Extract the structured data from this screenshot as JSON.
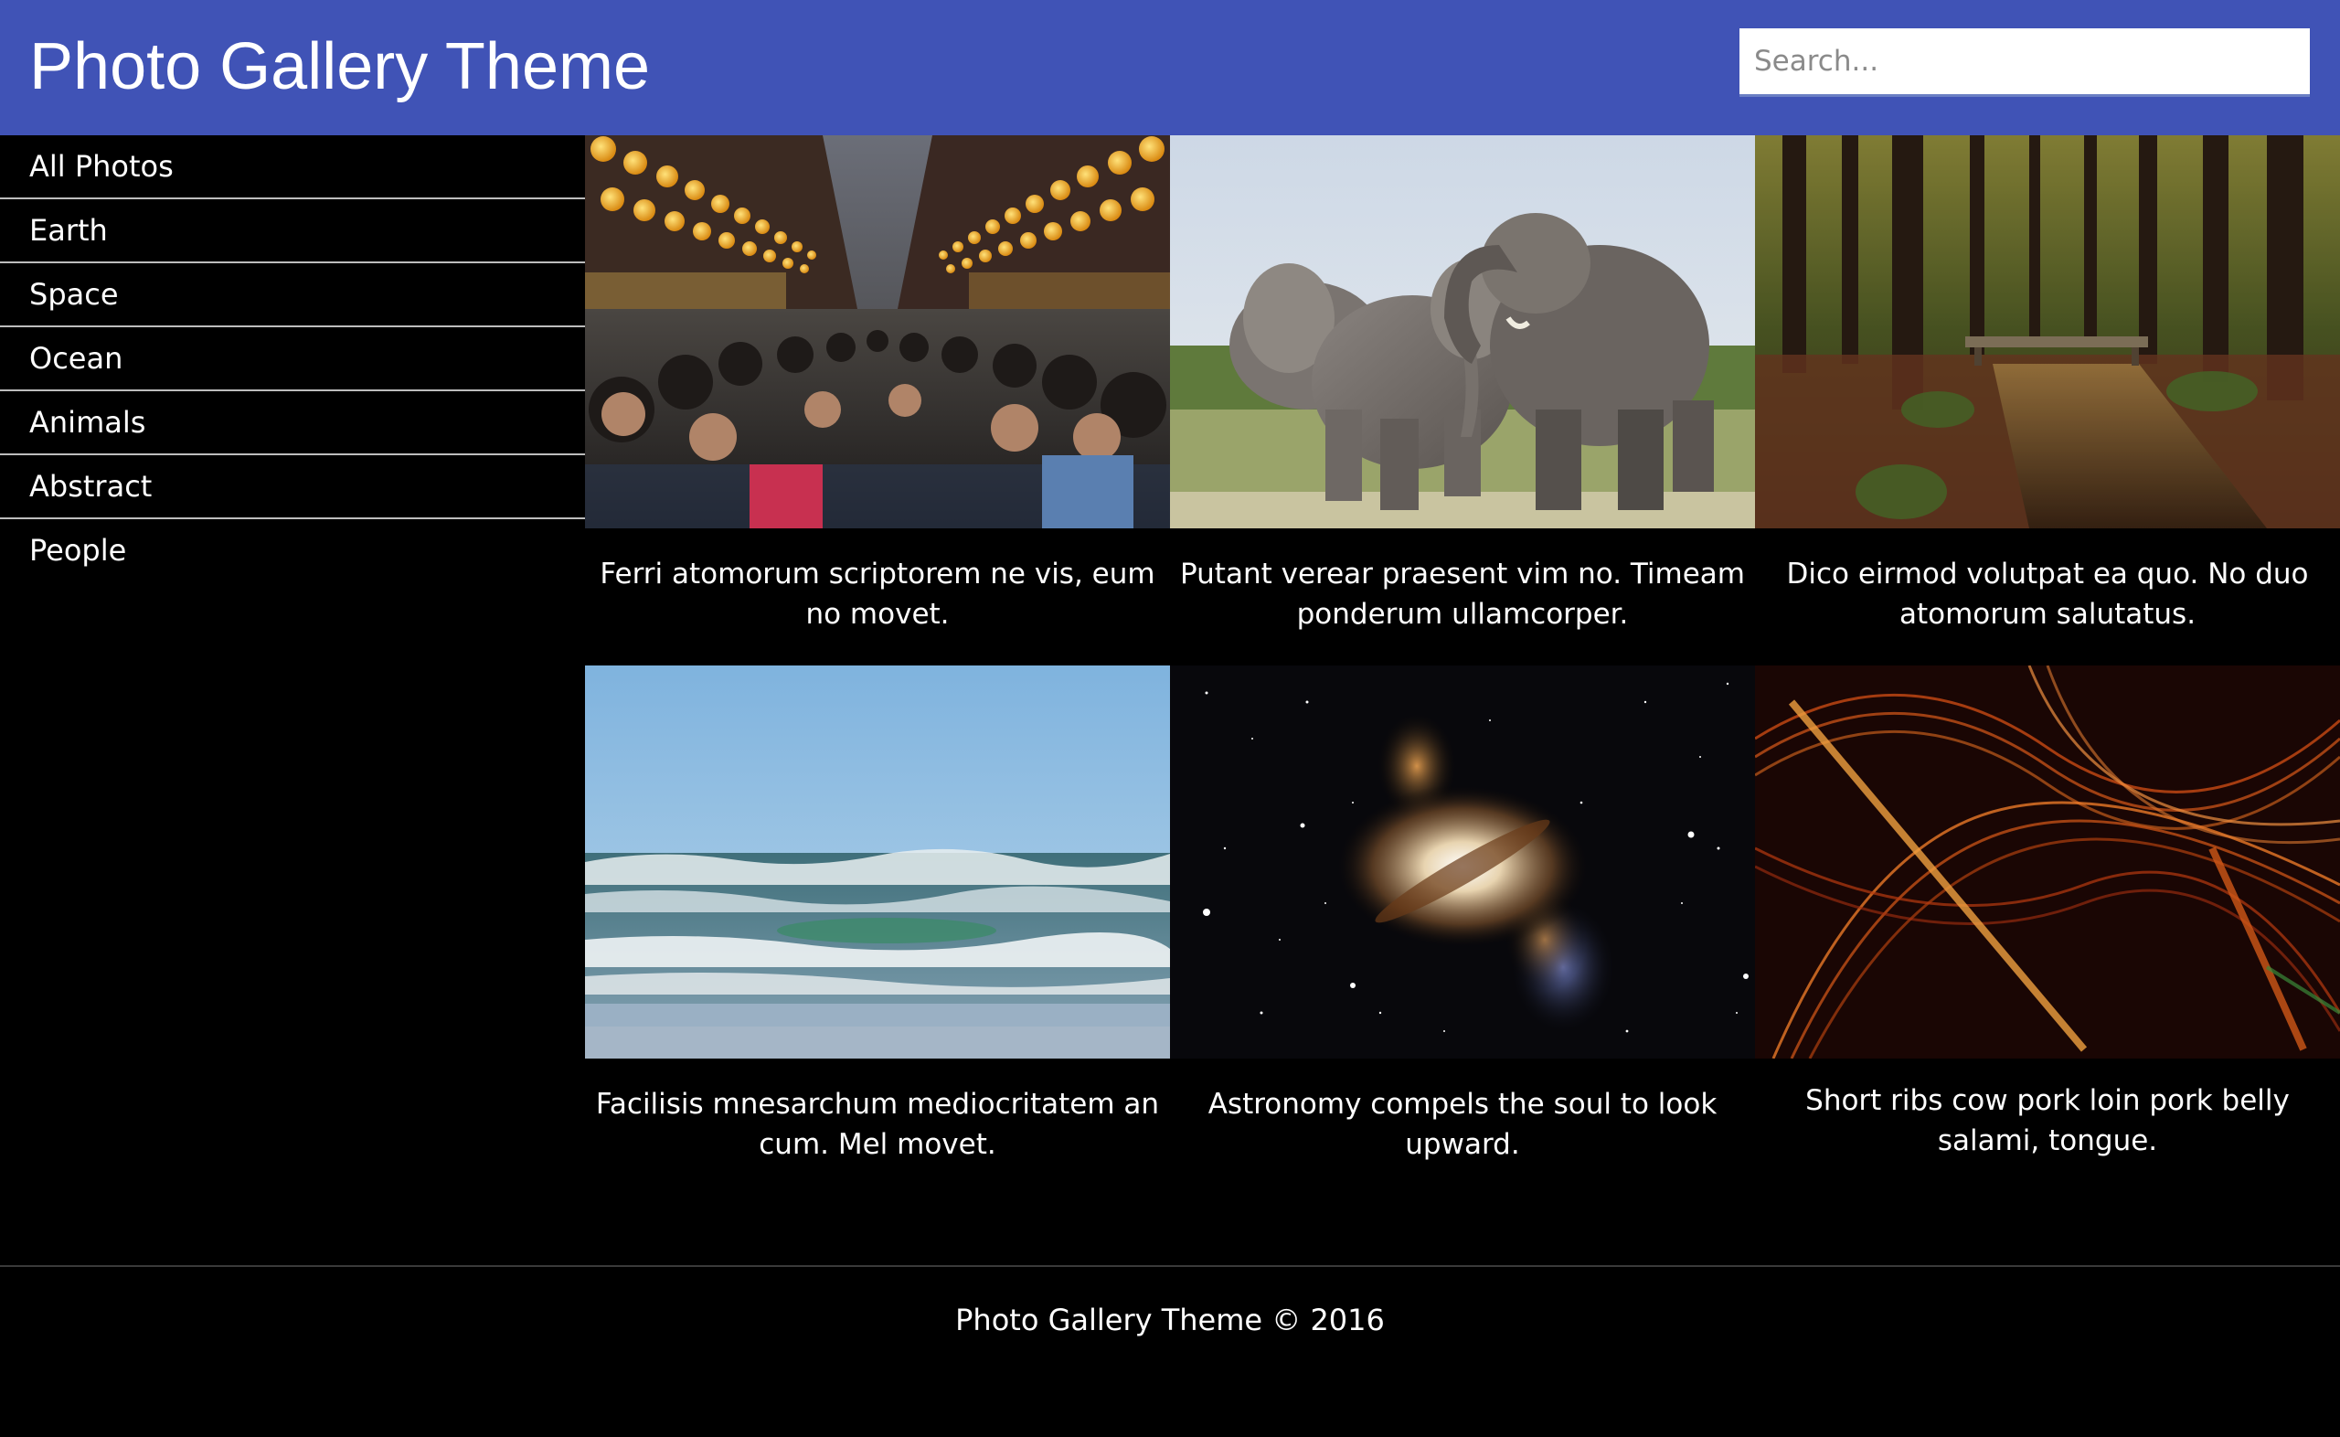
{
  "header": {
    "title": "Photo Gallery Theme",
    "search_placeholder": "Search...",
    "background_color": "#4053b6"
  },
  "sidebar": {
    "items": [
      {
        "label": "All Photos"
      },
      {
        "label": "Earth"
      },
      {
        "label": "Space"
      },
      {
        "label": "Ocean"
      },
      {
        "label": "Animals"
      },
      {
        "label": "Abstract"
      },
      {
        "label": "People"
      }
    ]
  },
  "gallery": {
    "cards": [
      {
        "image": "night-market-crowd-photo",
        "caption": "Ferri atomorum scriptorem ne vis, eum no movet."
      },
      {
        "image": "elephants-photo",
        "caption": "Putant verear praesent vim no. Timeam ponderum ullamcorper."
      },
      {
        "image": "forest-stream-photo",
        "caption": "Dico eirmod volutpat ea quo. No duo atomorum salutatus."
      },
      {
        "image": "ocean-waves-photo",
        "caption": "Facilisis mnesarchum mediocritatem an cum. Mel movet."
      },
      {
        "image": "galaxy-photo",
        "caption": "Astronomy compels the soul to look upward."
      },
      {
        "image": "abstract-orange-lines-photo",
        "caption": "Short ribs cow pork loin pork belly salami, tongue."
      }
    ]
  },
  "footer": {
    "text": "Photo Gallery Theme © 2016"
  }
}
